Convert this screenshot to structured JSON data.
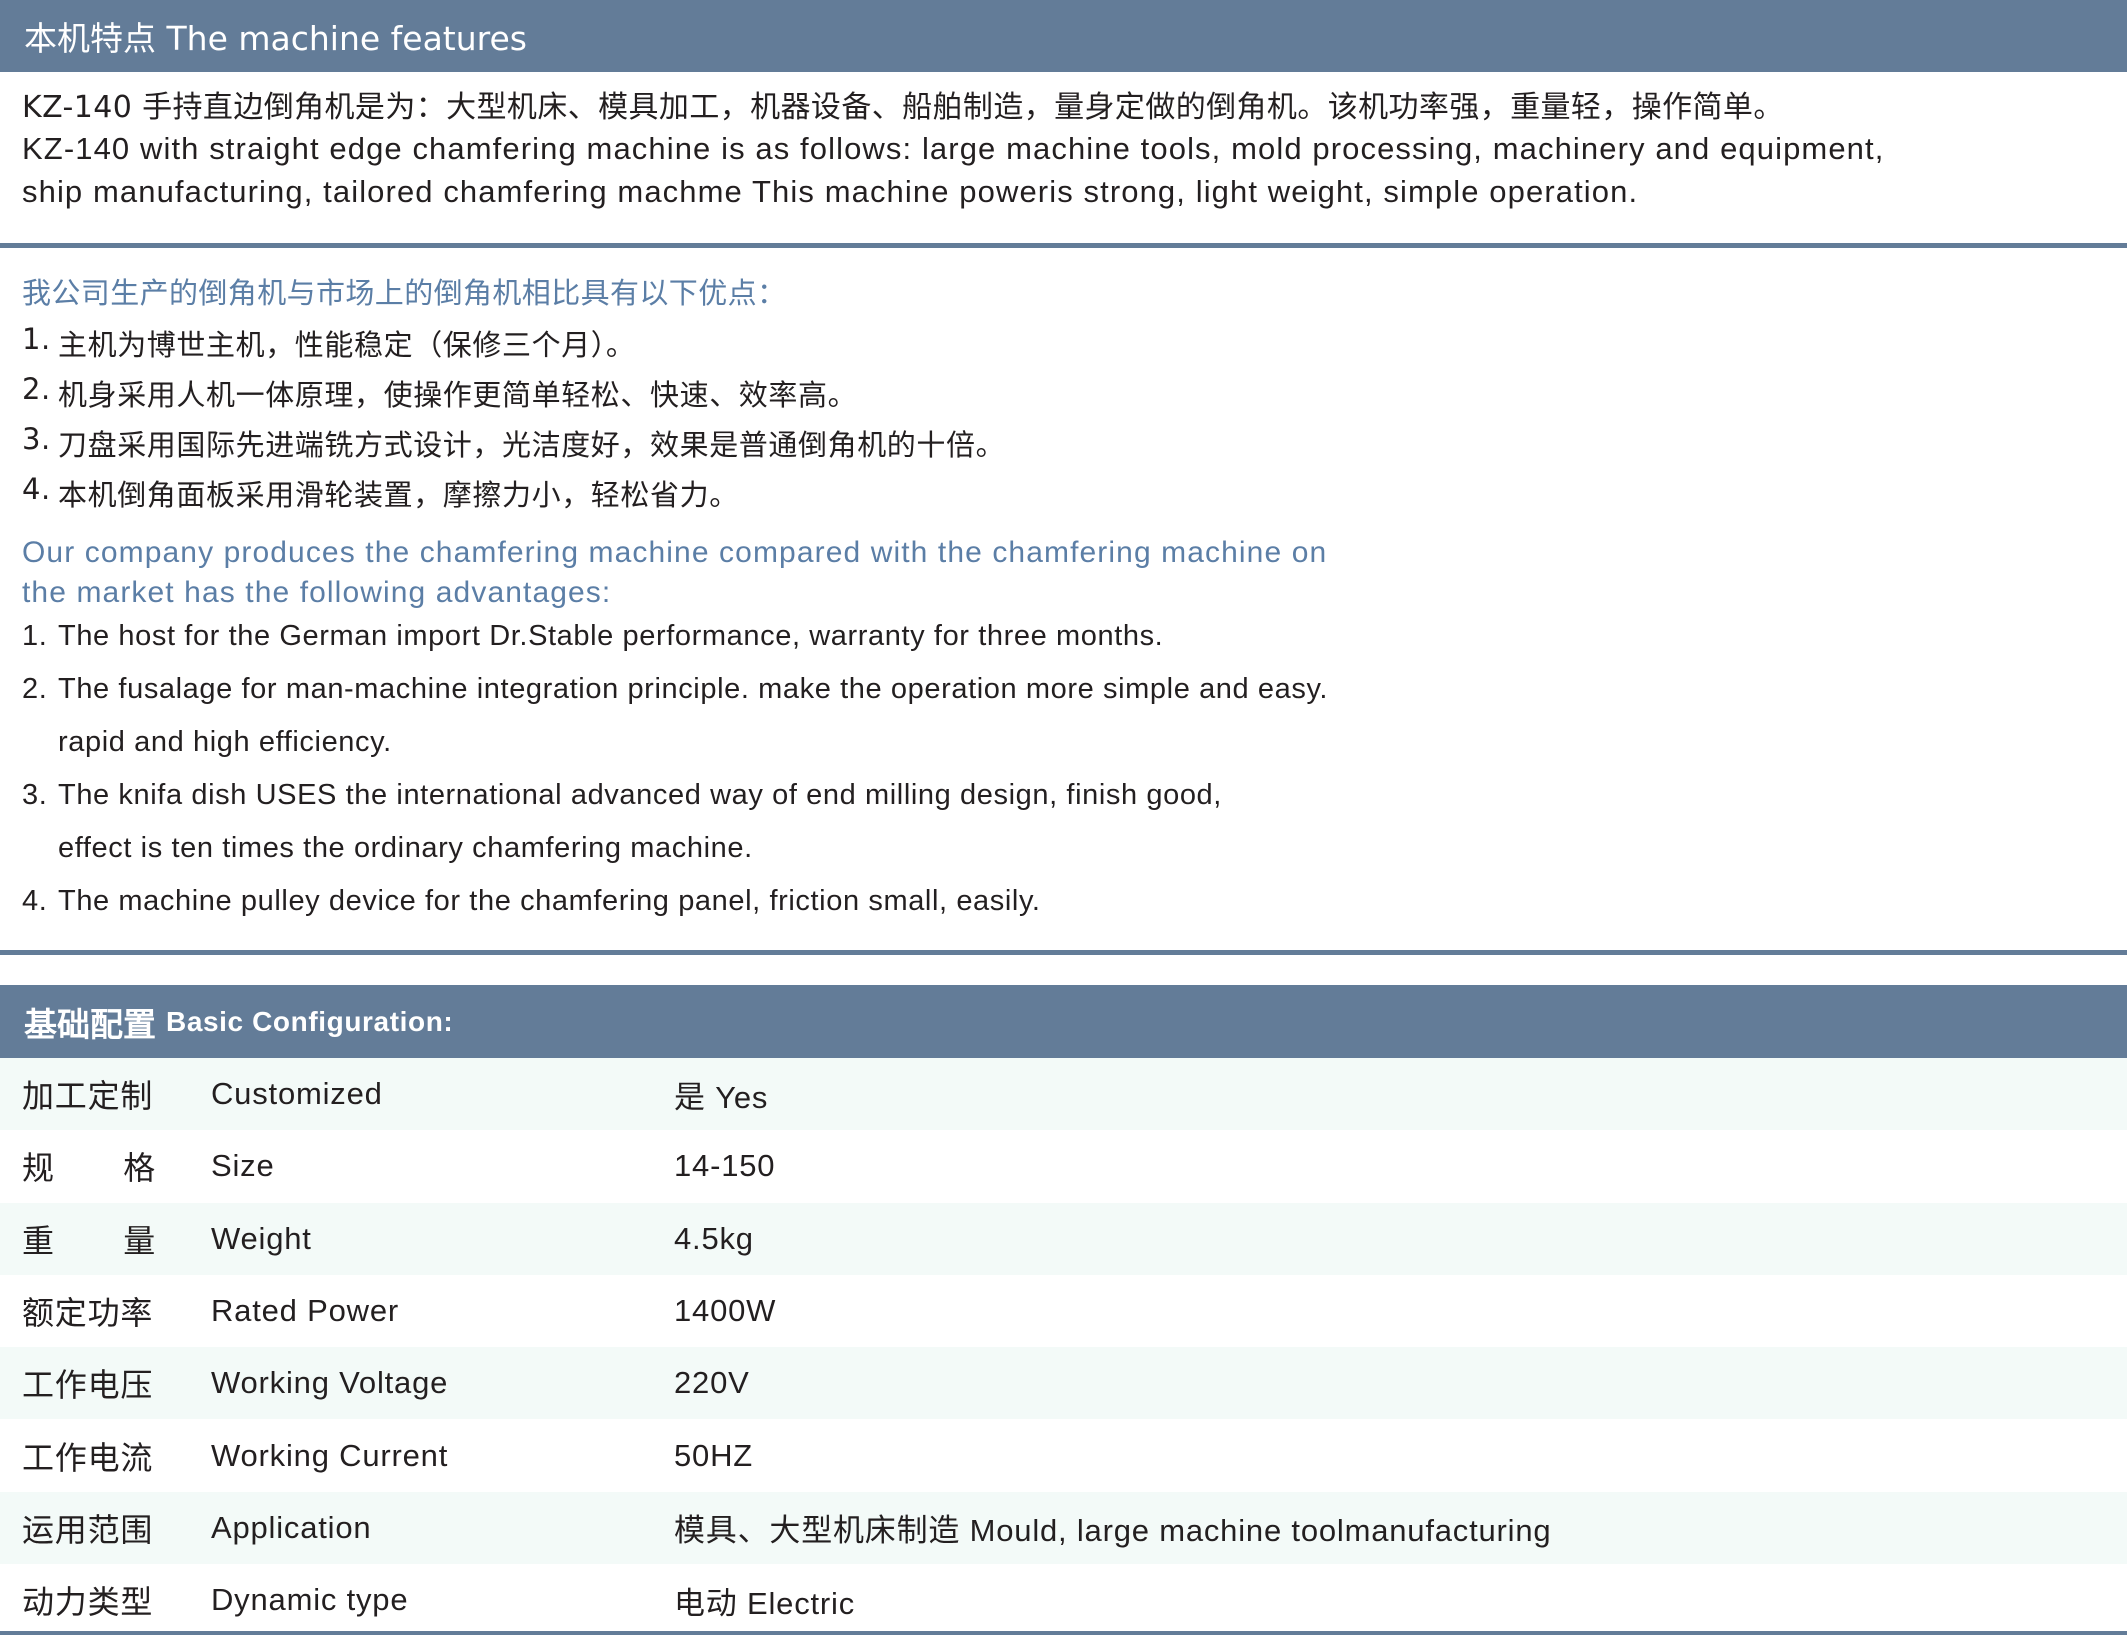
{
  "features": {
    "heading": "本机特点 The machine features",
    "desc_cn": "KZ-140 手持直边倒角机是为：大型机床、模具加工，机器设备、船舶制造，量身定做的倒角机。该机功率强，重量轻，操作简单。",
    "desc_en_1": "KZ-140 with straight edge chamfering machine is as follows: large machine tools, mold processing, machinery and equipment,",
    "desc_en_2": "ship manufacturing, tailored chamfering machme This machine poweris strong, light weight, simple operation."
  },
  "advantages": {
    "title_cn": "我公司生产的倒角机与市场上的倒角机相比具有以下优点：",
    "items_cn": [
      {
        "num": "1.",
        "text": "主机为博世主机，性能稳定（保修三个月）。"
      },
      {
        "num": "2.",
        "text": "机身采用人机一体原理，使操作更简单轻松、快速、效率高。"
      },
      {
        "num": "3.",
        "text": "刀盘采用国际先进端铣方式设计，光洁度好，效果是普通倒角机的十倍。"
      },
      {
        "num": "4.",
        "text": "本机倒角面板采用滑轮装置，摩擦力小，轻松省力。"
      }
    ],
    "title_en_1": "Our company produces the chamfering machine compared with the chamfering machine on",
    "title_en_2": "the market has the following advantages:",
    "items_en": [
      {
        "num": "1.",
        "text": "The host for the German import Dr.Stable performance, warranty for three months.",
        "cont": ""
      },
      {
        "num": "2.",
        "text": "The fusalage for man-machine integration principle. make the operation more simple and easy.",
        "cont": "rapid and high efficiency."
      },
      {
        "num": "3.",
        "text": "The knifa dish USES the international advanced way of end milling design, finish good,",
        "cont": "effect is ten times the ordinary chamfering machine."
      },
      {
        "num": "4.",
        "text": "The machine pulley device for the chamfering panel, friction small, easily.",
        "cont": ""
      }
    ]
  },
  "config": {
    "heading_cn": "基础配置",
    "heading_en": "Basic Configuration:",
    "rows": [
      {
        "cn": "加工定制",
        "en": "Customized",
        "value": "是 Yes"
      },
      {
        "cn": "规格",
        "en": "Size",
        "value": "14-150"
      },
      {
        "cn": "重量",
        "en": "Weight",
        "value": "4.5kg"
      },
      {
        "cn": "额定功率",
        "en": "Rated Power",
        "value": "1400W"
      },
      {
        "cn": "工作电压",
        "en": "Working Voltage",
        "value": "220V"
      },
      {
        "cn": "工作电流",
        "en": "Working Current",
        "value": "50HZ"
      },
      {
        "cn": "运用范围",
        "en": "Application",
        "value": "模具、大型机床制造 Mould, large machine toolmanufacturing"
      },
      {
        "cn": "动力类型",
        "en": "Dynamic type",
        "value": "电动 Electric"
      }
    ]
  },
  "colors": {
    "header_bar": "#637c98",
    "accent_text": "#5b7ea6",
    "row_shade": "#f3faf8",
    "body_text": "#231f20"
  }
}
